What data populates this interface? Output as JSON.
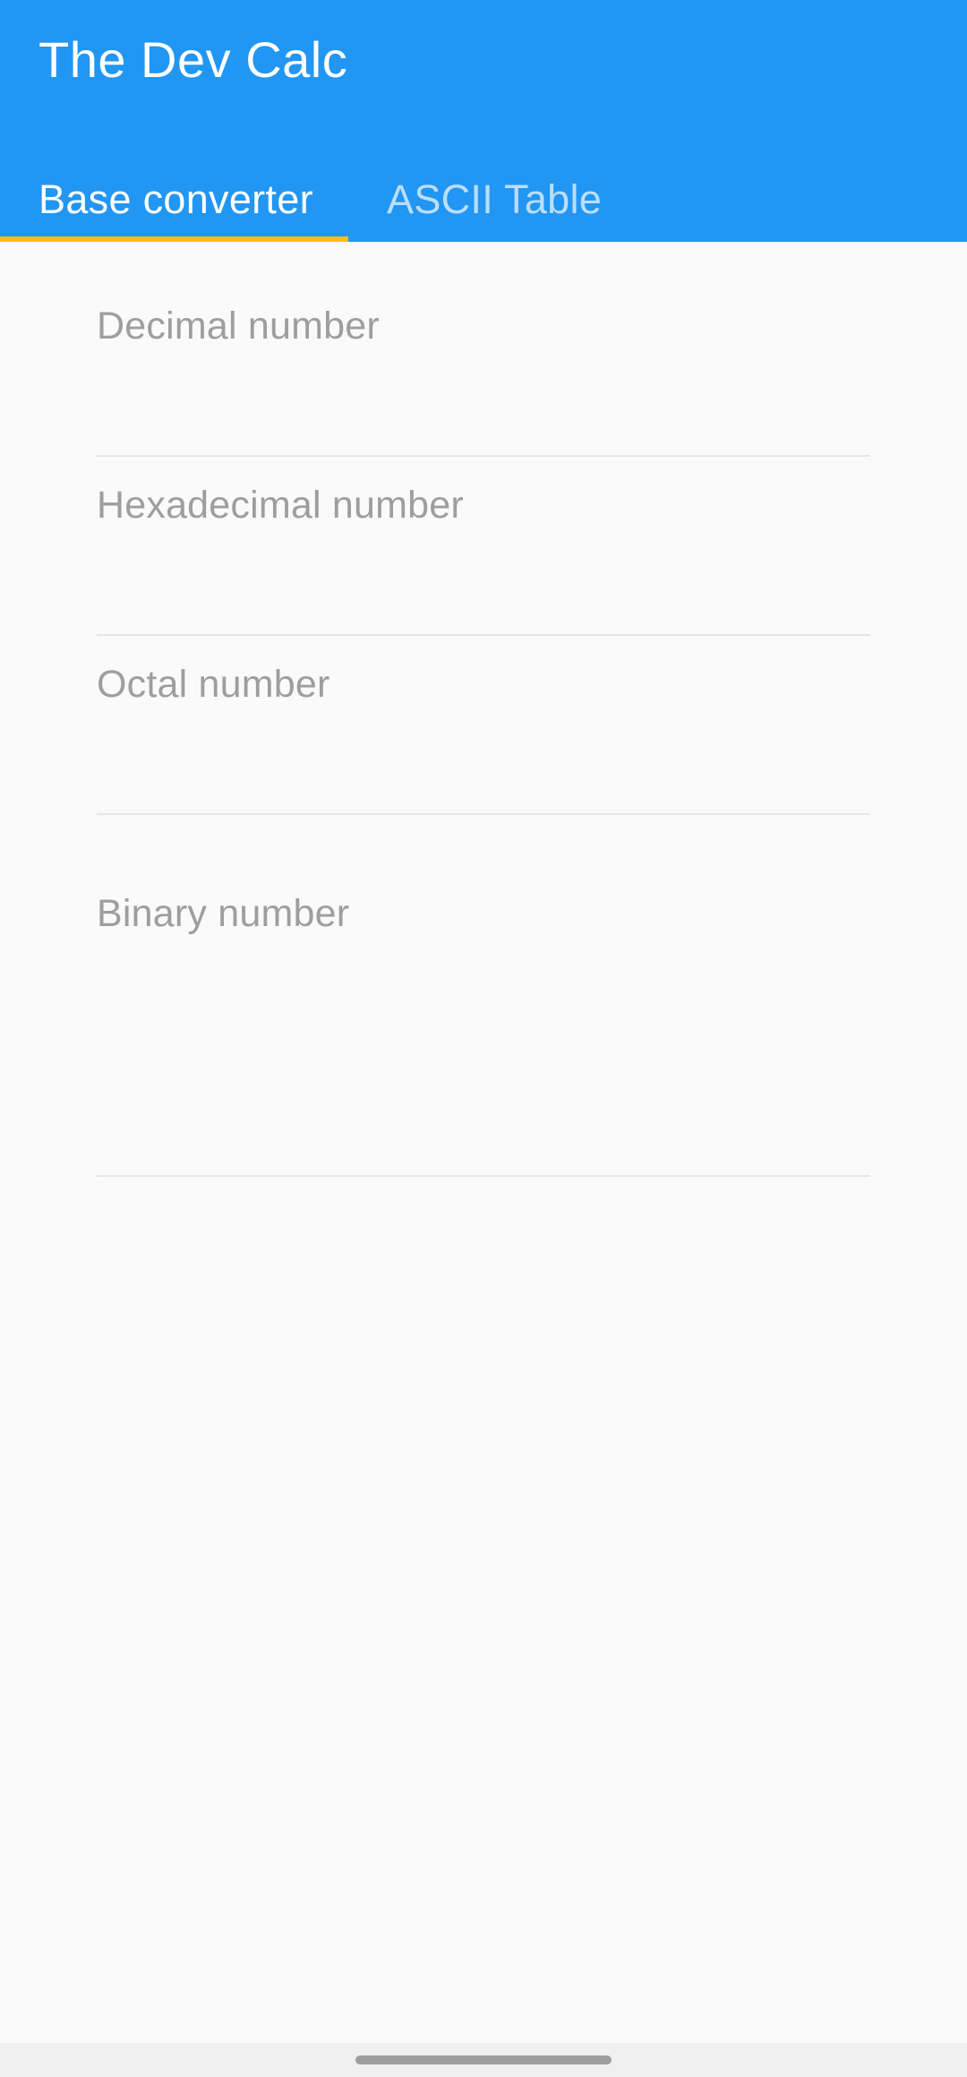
{
  "app": {
    "title": "The Dev Calc",
    "primary_color": "#2196f3",
    "accent_color": "#ffc107"
  },
  "tabs": [
    {
      "label": "Base converter",
      "selected": true
    },
    {
      "label": "ASCII Table",
      "selected": false
    }
  ],
  "fields": {
    "decimal": {
      "label": "Decimal number",
      "value": ""
    },
    "hexadecimal": {
      "label": "Hexadecimal number",
      "value": ""
    },
    "octal": {
      "label": "Octal number",
      "value": ""
    },
    "binary": {
      "label": "Binary number",
      "value": ""
    }
  }
}
